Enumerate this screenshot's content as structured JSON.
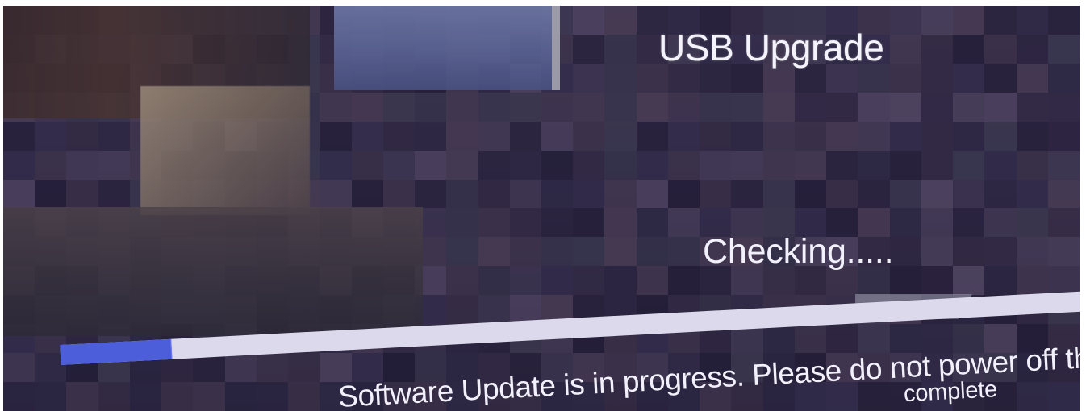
{
  "dialog": {
    "title": "USB Upgrade",
    "status_text": "Checking.....",
    "progress": 0.106,
    "progress_colors": {
      "track": "#ddd9ec",
      "fill": "#4c5ed9"
    },
    "message_line1": "Software Update is in progress. Please do not power off th",
    "message_line2": "complete"
  },
  "colors": {
    "screen_background": "#2c2542",
    "text": "#f2f0fa"
  }
}
